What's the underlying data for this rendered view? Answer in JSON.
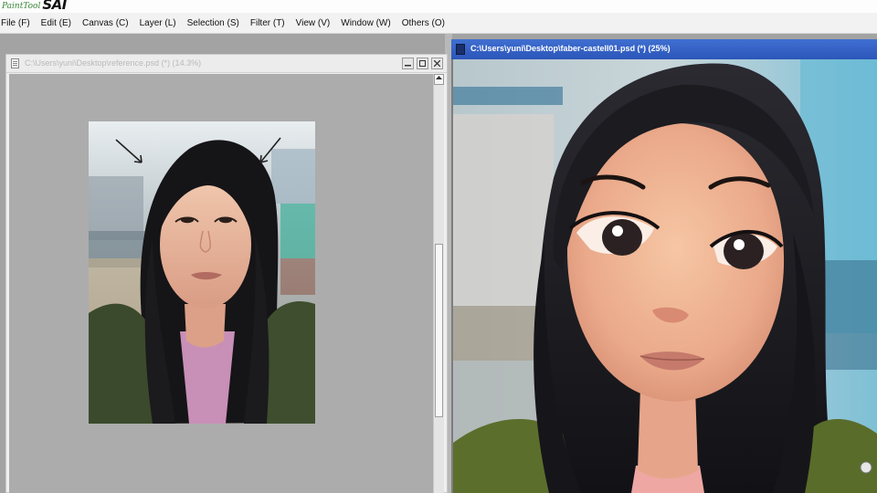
{
  "app": {
    "logo_small": "PaintTool",
    "logo_big": "SAI"
  },
  "menu": [
    {
      "label": "File (F)"
    },
    {
      "label": "Edit (E)"
    },
    {
      "label": "Canvas (C)"
    },
    {
      "label": "Layer (L)"
    },
    {
      "label": "Selection (S)"
    },
    {
      "label": "Filter (T)"
    },
    {
      "label": "View (V)"
    },
    {
      "label": "Window (W)"
    },
    {
      "label": "Others (O)"
    }
  ],
  "ref_window": {
    "title": "C:\\Users\\yuni\\Desktop\\reference.psd (*) (14.3%)",
    "icon": "document-icon"
  },
  "main_window": {
    "title": "C:\\Users\\yuni\\Desktop\\faber-castell01.psd (*) (25%)",
    "icon": "document-icon"
  },
  "colors": {
    "active_title": "#3565c8",
    "inactive_title": "#ececec",
    "workspace": "#a3a3a3"
  }
}
